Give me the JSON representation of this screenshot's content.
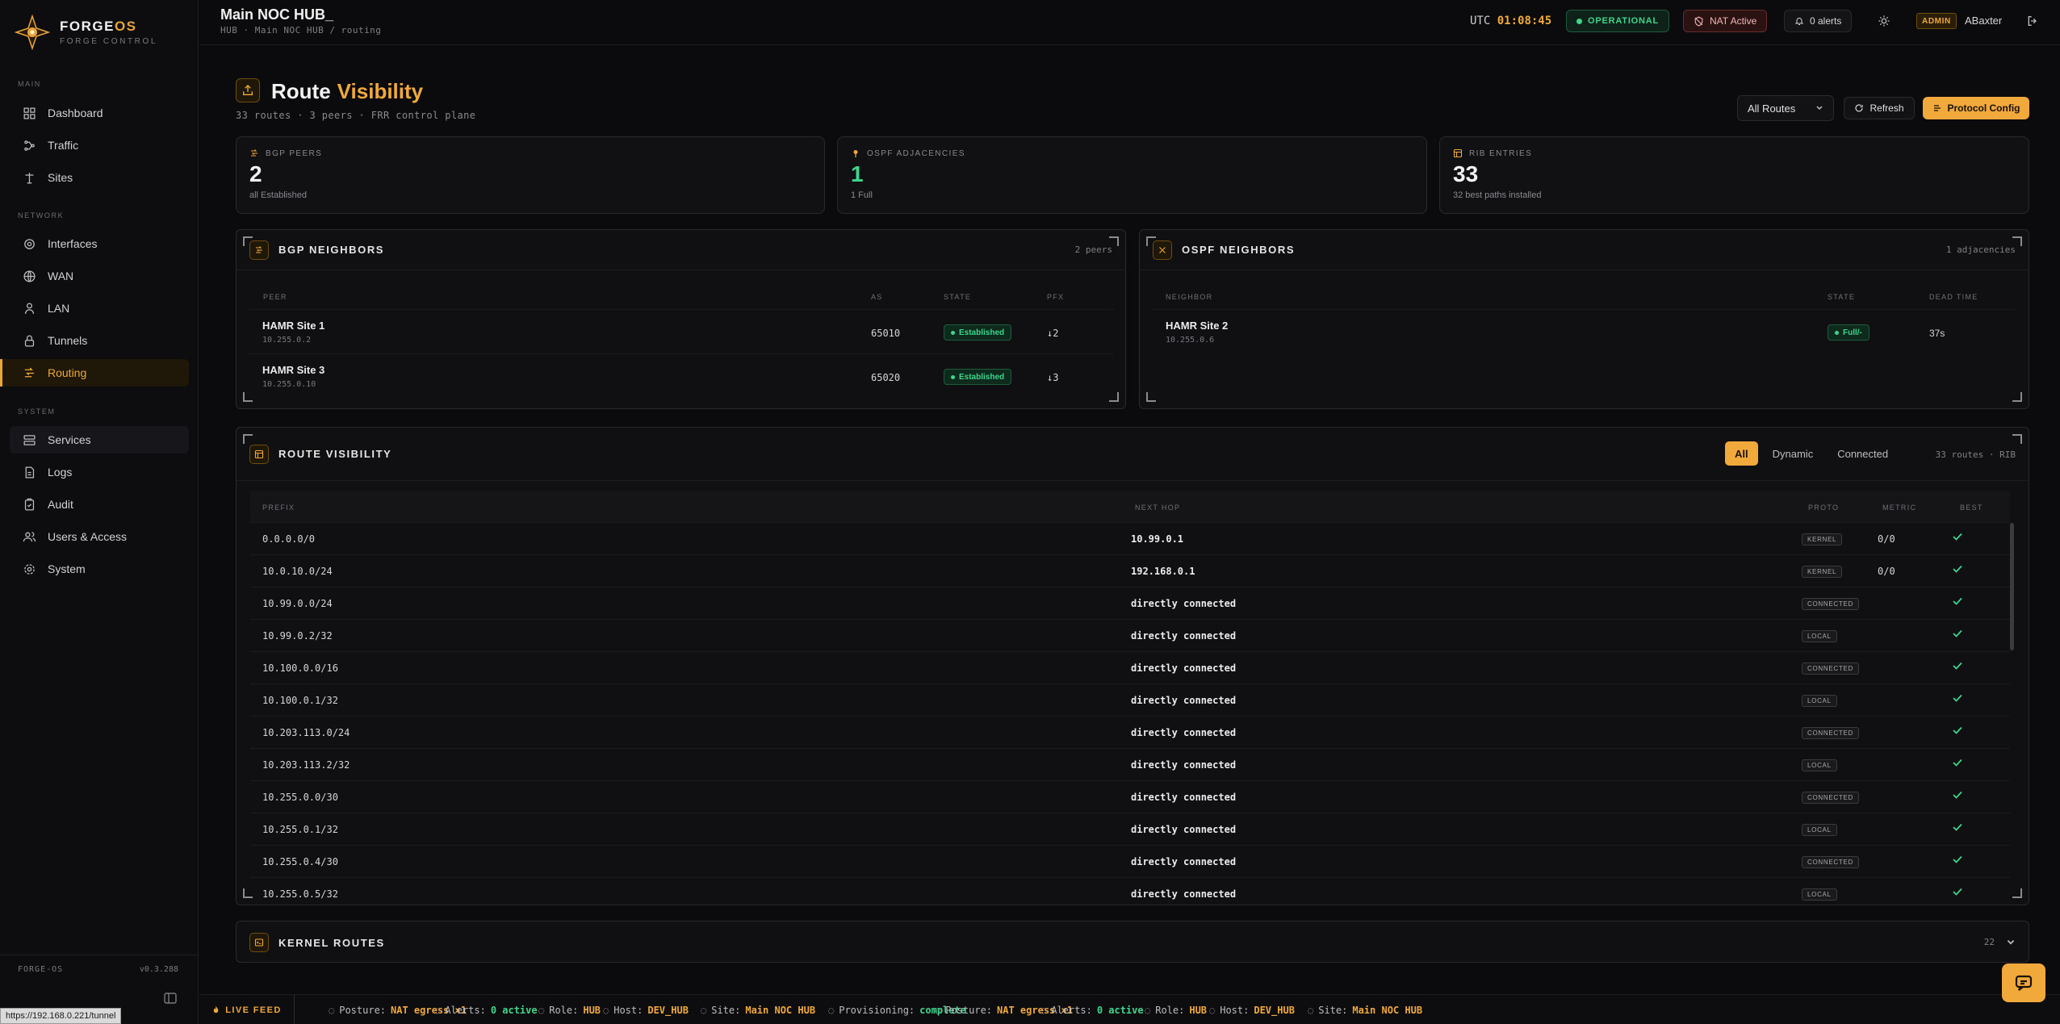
{
  "brand": {
    "name_a": "FORGE",
    "name_b": "OS",
    "subtitle": "FORGE CONTROL"
  },
  "sidebar": {
    "sections": [
      "MAIN",
      "NETWORK",
      "SYSTEM"
    ],
    "items": [
      {
        "label": "Dashboard",
        "icon": "dashboard-icon"
      },
      {
        "label": "Traffic",
        "icon": "traffic-icon"
      },
      {
        "label": "Sites",
        "icon": "sites-icon"
      },
      {
        "label": "Interfaces",
        "icon": "interfaces-icon"
      },
      {
        "label": "WAN",
        "icon": "globe-icon"
      },
      {
        "label": "LAN",
        "icon": "lan-icon"
      },
      {
        "label": "Tunnels",
        "icon": "lock-icon"
      },
      {
        "label": "Routing",
        "icon": "routing-icon"
      },
      {
        "label": "Services",
        "icon": "services-icon"
      },
      {
        "label": "Logs",
        "icon": "logs-icon"
      },
      {
        "label": "Audit",
        "icon": "audit-icon"
      },
      {
        "label": "Users & Access",
        "icon": "users-icon"
      },
      {
        "label": "System",
        "icon": "gear-icon"
      }
    ],
    "footer_left": "FORGE-OS",
    "footer_version": "v0.3.288",
    "status_url": "https://192.168.0.221/tunnel"
  },
  "header": {
    "title": "Main NOC HUB_",
    "breadcrumb": "HUB · Main NOC HUB / routing",
    "utc_label": "UTC",
    "utc_time": "01:08:45",
    "status": "OPERATIONAL",
    "nat": "NAT Active",
    "alerts": "0 alerts",
    "role_badge": "ADMIN",
    "user": "ABaxter"
  },
  "page": {
    "title_a": "Route",
    "title_b": "Visibility",
    "subtitle": "33 routes · 3 peers · FRR control plane",
    "filter_value": "All Routes",
    "refresh_label": "Refresh",
    "config_label": "Protocol Config"
  },
  "stats": [
    {
      "label": "BGP PEERS",
      "value": "2",
      "note": "all Established"
    },
    {
      "label": "OSPF ADJACENCIES",
      "value": "1",
      "note": "1 Full"
    },
    {
      "label": "RIB ENTRIES",
      "value": "33",
      "note": "32 best paths installed"
    }
  ],
  "bgp": {
    "title": "BGP NEIGHBORS",
    "meta": "2 peers",
    "columns": [
      "PEER",
      "AS",
      "STATE",
      "PFX"
    ],
    "rows": [
      {
        "name": "HAMR Site 1",
        "ip": "10.255.0.2",
        "as": "65010",
        "state": "Established",
        "pfx": "↓2"
      },
      {
        "name": "HAMR Site 3",
        "ip": "10.255.0.10",
        "as": "65020",
        "state": "Established",
        "pfx": "↓3"
      }
    ]
  },
  "ospf": {
    "title": "OSPF NEIGHBORS",
    "meta": "1 adjacencies",
    "columns": [
      "NEIGHBOR",
      "STATE",
      "DEAD TIME"
    ],
    "rows": [
      {
        "name": "HAMR Site 2",
        "ip": "10.255.0.6",
        "state": "Full/-",
        "dead": "37s"
      }
    ]
  },
  "routes": {
    "title": "ROUTE VISIBILITY",
    "tabs": [
      "All",
      "Dynamic",
      "Connected"
    ],
    "meta": "33 routes · RIB",
    "columns": [
      "PREFIX",
      "NEXT HOP",
      "PROTO",
      "METRIC",
      "BEST"
    ],
    "rows": [
      {
        "prefix": "0.0.0.0/0",
        "hop": "10.99.0.1",
        "proto": "KERNEL",
        "metric": "0/0"
      },
      {
        "prefix": "10.0.10.0/24",
        "hop": "192.168.0.1",
        "proto": "KERNEL",
        "metric": "0/0"
      },
      {
        "prefix": "10.99.0.0/24",
        "hop": "directly connected",
        "proto": "CONNECTED",
        "metric": ""
      },
      {
        "prefix": "10.99.0.2/32",
        "hop": "directly connected",
        "proto": "LOCAL",
        "metric": ""
      },
      {
        "prefix": "10.100.0.0/16",
        "hop": "directly connected",
        "proto": "CONNECTED",
        "metric": ""
      },
      {
        "prefix": "10.100.0.1/32",
        "hop": "directly connected",
        "proto": "LOCAL",
        "metric": ""
      },
      {
        "prefix": "10.203.113.0/24",
        "hop": "directly connected",
        "proto": "CONNECTED",
        "metric": ""
      },
      {
        "prefix": "10.203.113.2/32",
        "hop": "directly connected",
        "proto": "LOCAL",
        "metric": ""
      },
      {
        "prefix": "10.255.0.0/30",
        "hop": "directly connected",
        "proto": "CONNECTED",
        "metric": ""
      },
      {
        "prefix": "10.255.0.1/32",
        "hop": "directly connected",
        "proto": "LOCAL",
        "metric": ""
      },
      {
        "prefix": "10.255.0.4/30",
        "hop": "directly connected",
        "proto": "CONNECTED",
        "metric": ""
      },
      {
        "prefix": "10.255.0.5/32",
        "hop": "directly connected",
        "proto": "LOCAL",
        "metric": ""
      }
    ]
  },
  "kernel": {
    "title": "KERNEL ROUTES",
    "count": "22"
  },
  "ticker": {
    "live_label": "LIVE FEED",
    "items": [
      {
        "k": "Posture:",
        "v": "NAT egress ×1",
        "c": "amber",
        "icon": "shield-icon"
      },
      {
        "k": "Alerts:",
        "v": "0 active",
        "c": "green",
        "icon": "bell-icon"
      },
      {
        "k": "Role:",
        "v": "HUB",
        "c": "amber",
        "icon": "role-icon"
      },
      {
        "k": "Host:",
        "v": "DEV_HUB",
        "c": "amber",
        "icon": "host-icon"
      },
      {
        "k": "Site:",
        "v": "Main NOC HUB",
        "c": "amber",
        "icon": "site-icon"
      },
      {
        "k": "Provisioning:",
        "v": "complete",
        "c": "green",
        "icon": "check-circle-icon"
      },
      {
        "k": "Posture:",
        "v": "NAT egress ×1",
        "c": "amber",
        "icon": "shield-icon"
      },
      {
        "k": "Alerts:",
        "v": "0 active",
        "c": "green",
        "icon": "bell-icon"
      },
      {
        "k": "Role:",
        "v": "HUB",
        "c": "amber",
        "icon": "role-icon"
      },
      {
        "k": "Host:",
        "v": "DEV_HUB",
        "c": "amber",
        "icon": "host-icon"
      },
      {
        "k": "Site:",
        "v": "Main NOC HUB",
        "c": "amber",
        "icon": "site-icon"
      }
    ]
  },
  "colors": {
    "accent": "#f0a93a",
    "ok": "#3dd68c",
    "danger": "#6b2c2c"
  }
}
